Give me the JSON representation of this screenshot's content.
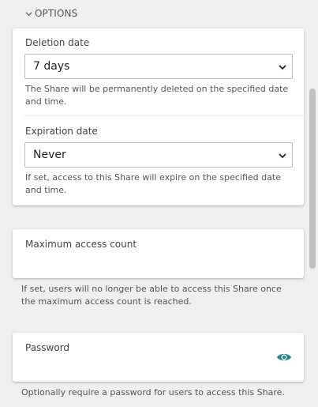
{
  "options_section": {
    "label": "OPTIONS"
  },
  "deletion": {
    "label": "Deletion date",
    "value": "7 days",
    "help": "The Share will be permanently deleted on the specified date and time."
  },
  "expiration": {
    "label": "Expiration date",
    "value": "Never",
    "help": "If set, access to this Share will expire on the specified date and time."
  },
  "max_access": {
    "label": "Maximum access count",
    "help": "If set, users will no longer be able to access this Share once the maximum access count is reached."
  },
  "password": {
    "label": "Password",
    "help": "Optionally require a password for users to access this Share."
  },
  "icons": {
    "section_toggle": "chevron-down-icon",
    "select_arrow": "chevron-down-icon",
    "password_visibility": "eye-icon"
  },
  "colors": {
    "accent": "#1a8a8a",
    "background": "#efefef"
  }
}
